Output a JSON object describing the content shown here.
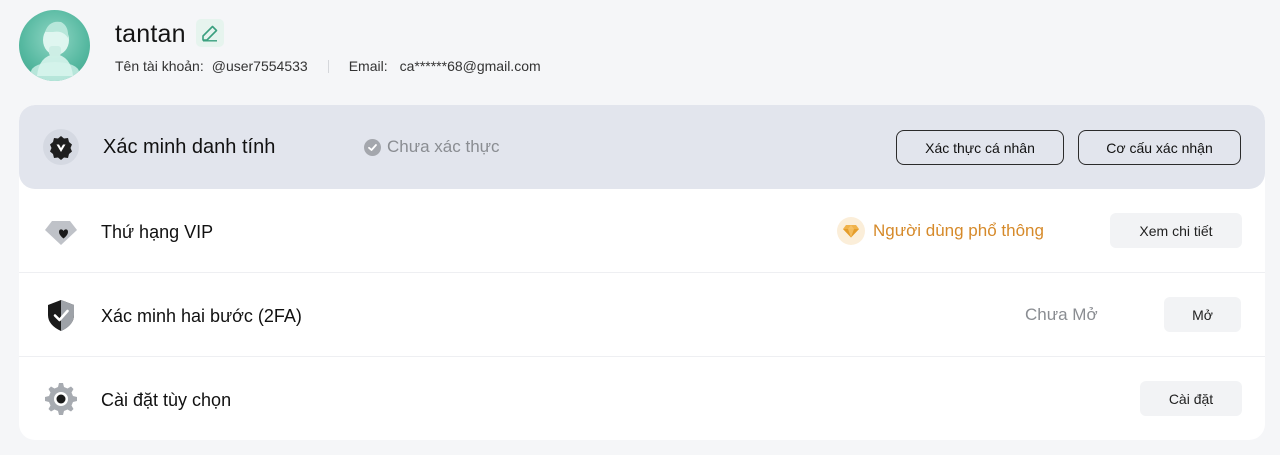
{
  "profile": {
    "username": "tantan",
    "account_label": "Tên tài khoản:",
    "account_value": "@user7554533",
    "email_label": "Email:",
    "email_value": "ca******68@gmail.com"
  },
  "identity": {
    "title": "Xác minh danh tính",
    "status": "Chưa xác thực",
    "personal_button": "Xác thực cá nhân",
    "institution_button": "Cơ cấu xác nhận"
  },
  "vip": {
    "title": "Thứ hạng VIP",
    "level": "Người dùng phổ thông",
    "details_button": "Xem chi tiết"
  },
  "twofa": {
    "title": "Xác minh hai bước (2FA)",
    "status": "Chưa Mở",
    "enable_button": "Mở"
  },
  "preferences": {
    "title": "Cài đặt tùy chọn",
    "settings_button": "Cài đặt"
  },
  "colors": {
    "accent_green": "#55b8a0",
    "vip_gold": "#d68a2a",
    "kyc_background": "#e2e5ed"
  },
  "icons": {
    "edit": "pencil-icon",
    "identity": "verified-badge-icon",
    "status": "check-circle-icon",
    "vip": "diamond-heart-icon",
    "vip_level": "gem-icon",
    "twofa": "shield-check-icon",
    "preferences": "gear-icon"
  }
}
